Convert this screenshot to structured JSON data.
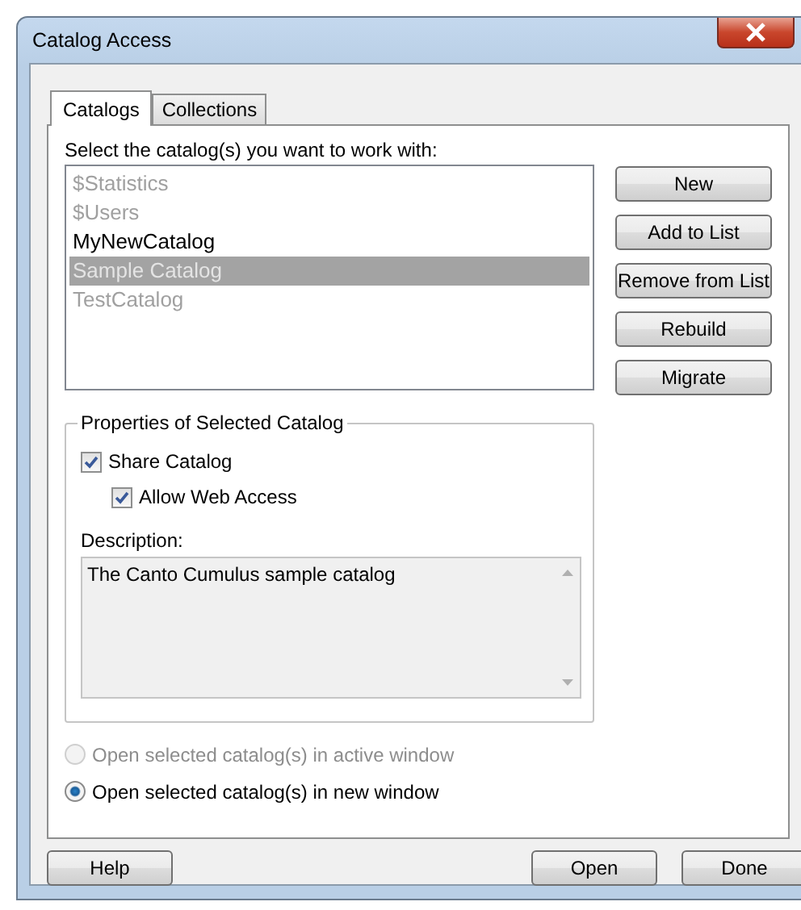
{
  "window": {
    "title": "Catalog Access"
  },
  "tabs": [
    {
      "label": "Catalogs",
      "selected": true
    },
    {
      "label": "Collections",
      "selected": false
    }
  ],
  "catalog_list": {
    "label": "Select the catalog(s) you want to work with:",
    "items": [
      {
        "label": "$Statistics",
        "disabled": true,
        "selected": false
      },
      {
        "label": "$Users",
        "disabled": true,
        "selected": false
      },
      {
        "label": "MyNewCatalog",
        "disabled": false,
        "selected": false
      },
      {
        "label": "Sample Catalog",
        "disabled": true,
        "selected": true
      },
      {
        "label": "TestCatalog",
        "disabled": true,
        "selected": false
      }
    ]
  },
  "side_buttons": [
    "New",
    "Add to List",
    "Remove from List",
    "Rebuild",
    "Migrate"
  ],
  "properties": {
    "title": "Properties of Selected Catalog",
    "checkboxes": [
      {
        "label": "Share Catalog",
        "checked": true,
        "children": [
          {
            "label": "Allow Web Access",
            "checked": true
          }
        ]
      }
    ],
    "description_label": "Description:",
    "description": "The Canto Cumulus sample catalog"
  },
  "open_options": [
    {
      "label": "Open selected catalog(s) in active window",
      "selected": false,
      "disabled": true
    },
    {
      "label": "Open selected catalog(s) in new window",
      "selected": true,
      "disabled": false
    }
  ],
  "footer_buttons": {
    "left": [
      "Help"
    ],
    "right": [
      "Open",
      "Done"
    ]
  }
}
